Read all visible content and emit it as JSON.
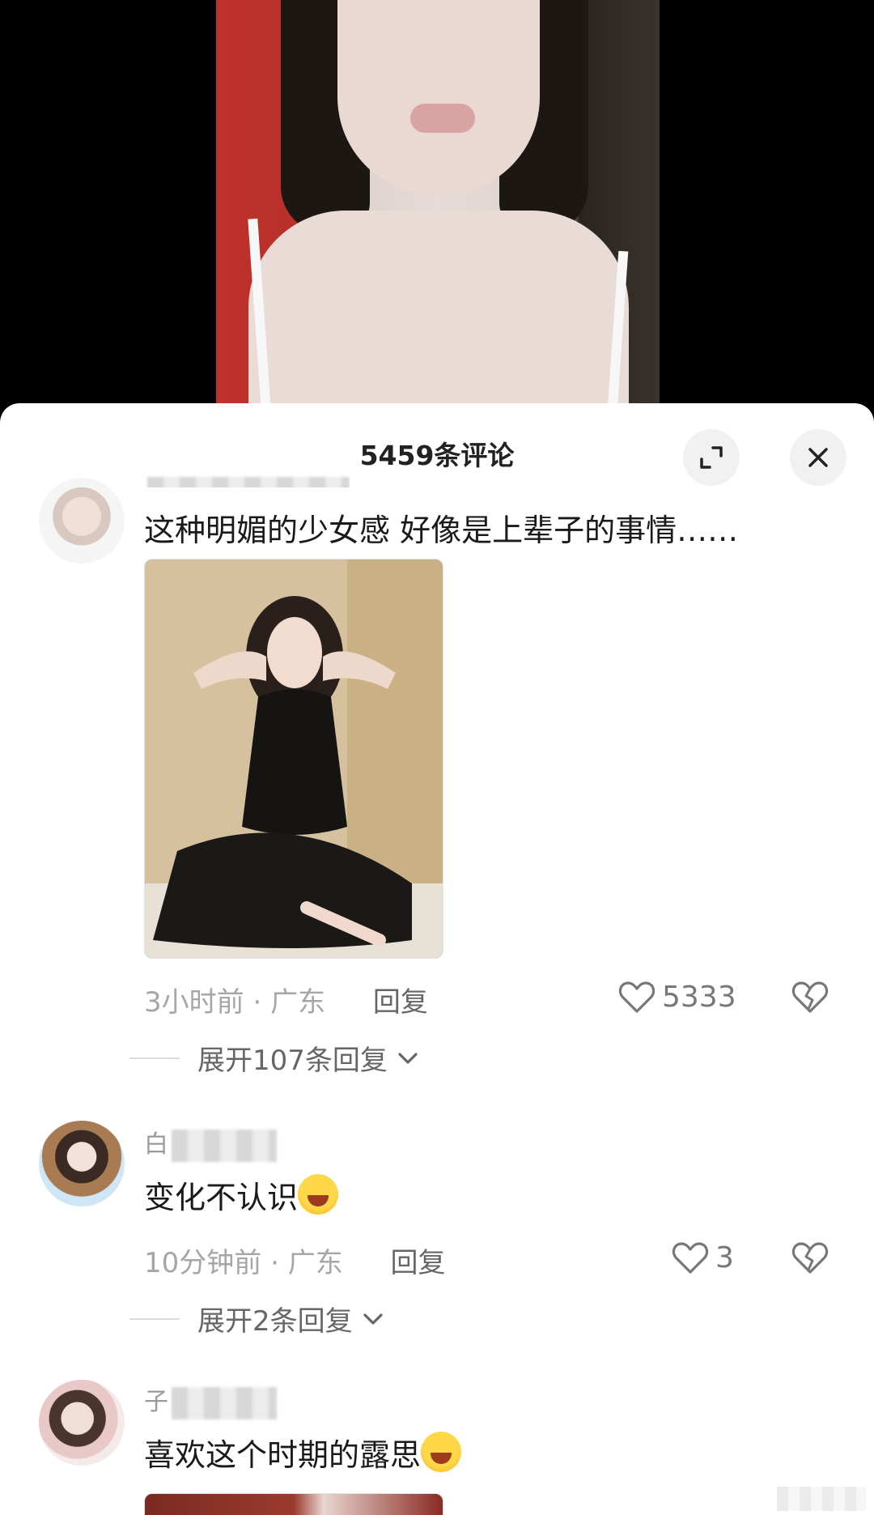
{
  "sheet": {
    "title": "5459条评论"
  },
  "comments": [
    {
      "username": "",
      "text": "这种明媚的少女感 好像是上辈子的事情……",
      "time": "3小时前",
      "location": "广东",
      "reply_label": "回复",
      "likes": "5333",
      "expand_label": "展开107条回复"
    },
    {
      "username": "白",
      "text": "变化不认识",
      "emoji": "laughing-tears-emoji",
      "time": "10分钟前",
      "location": "广东",
      "reply_label": "回复",
      "likes": "3",
      "expand_label": "展开2条回复"
    },
    {
      "username": "子",
      "text": "喜欢这个时期的露思",
      "emoji": "crying-face-emoji"
    }
  ],
  "icons": {
    "expand": "expand-icon",
    "close": "close-icon",
    "like": "heart-outline-icon",
    "dislike": "broken-heart-icon",
    "chevron": "chevron-down-icon"
  },
  "colors": {
    "sheet_bg": "#ffffff",
    "meta": "#a6a6a6",
    "text": "#1a1a1a"
  }
}
